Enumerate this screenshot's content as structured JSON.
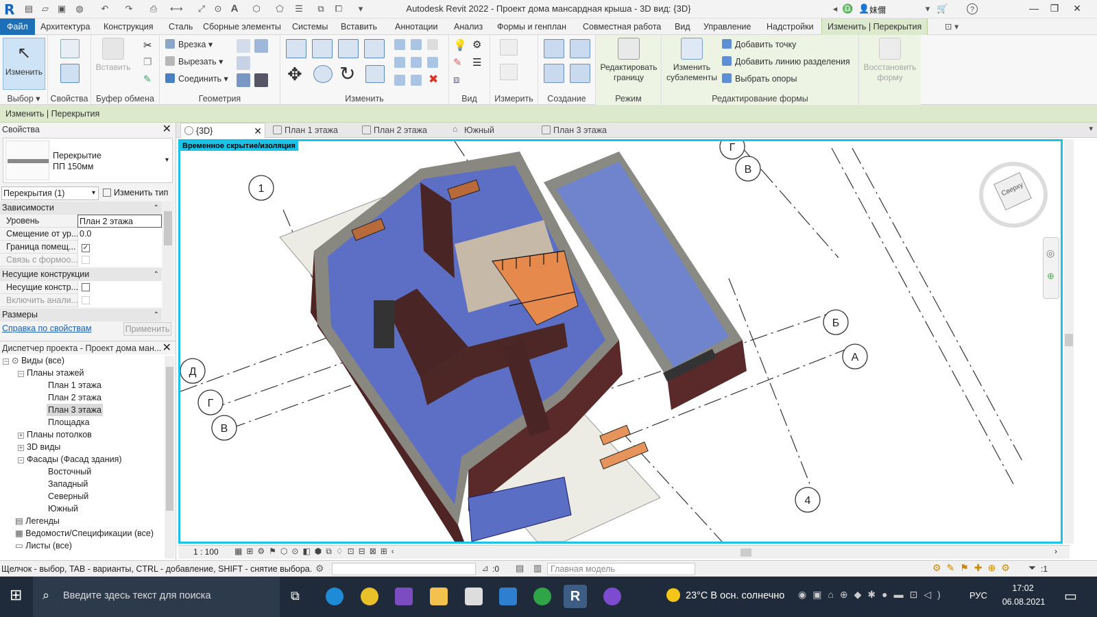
{
  "window": {
    "title": "Autodesk Revit 2022 - Проект дома мансардная крыша - 3D вид: {3D}",
    "user": "妺儞"
  },
  "menu_tabs": [
    "Файл",
    "Архитектура",
    "Конструкция",
    "Сталь",
    "Сборные элементы",
    "Системы",
    "Вставить",
    "Аннотации",
    "Анализ",
    "Формы и генплан",
    "Совместная работа",
    "Вид",
    "Управление",
    "Надстройки",
    "Изменить | Перекрытия"
  ],
  "ribbon": {
    "modify": "Изменить",
    "paste": "Вставить",
    "cut_join": [
      "Врезка",
      "Вырезать",
      "Соединить"
    ],
    "edit_boundary": "Редактировать границу",
    "modify_sub": "Изменить субэлементы",
    "shape_edit": [
      "Добавить точку",
      "Добавить линию разделения",
      "Выбрать опоры"
    ],
    "restore_shape": "Восстановить форму",
    "groups": {
      "select": "Выбор",
      "properties": "Свойства",
      "clipboard": "Буфер обмена",
      "geometry": "Геометрия",
      "modify": "Изменить",
      "view": "Вид",
      "measure": "Измерить",
      "create": "Создание",
      "mode": "Режим",
      "shape": "Редактирование формы"
    }
  },
  "option_bar": "Изменить | Перекрытия",
  "properties": {
    "title": "Свойства",
    "type_name": "Перекрытие",
    "type_sub": "ПП 150мм",
    "filter": "Перекрытия (1)",
    "edit_type": "Изменить тип",
    "cat_constraints": "Зависимости",
    "level_k": "Уровень",
    "level_v": "План 2 этажа",
    "offset_k": "Смещение от ур...",
    "offset_v": "0.0",
    "room_k": "Граница помещ...",
    "mass_k": "Связь с формоо...",
    "cat_structural": "Несущие конструкции",
    "struct_k": "Несущие констр...",
    "analytic_k": "Включить анали...",
    "cat_dimensions": "Размеры",
    "help": "Справка по свойствам",
    "apply": "Применить"
  },
  "browser": {
    "title": "Диспетчер проекта - Проект дома ман...",
    "nodes": [
      "Виды (все)",
      "Планы этажей",
      "План 1 этажа",
      "План 2 этажа",
      "План 3 этажа",
      "Площадка",
      "Планы потолков",
      "3D виды",
      "Фасады (Фасад здания)",
      "Восточный",
      "Западный",
      "Северный",
      "Южный",
      "Легенды",
      "Ведомости/Спецификации (все)",
      "Листы (все)"
    ]
  },
  "view_tabs": [
    "{3D}",
    "План 1 этажа",
    "План 2 этажа",
    "Южный",
    "План 3 этажа"
  ],
  "viewport": {
    "isolate_label": "Временное скрытие/изоляция",
    "grid_labels": [
      "1",
      "В",
      "Д",
      "Г",
      "В",
      "Б",
      "А",
      "4",
      "Г"
    ],
    "viewcube_label": "Сверху"
  },
  "view_control": {
    "scale": "1 : 100"
  },
  "status": {
    "hint": "Щелчок - выбор, TAB - варианты, CTRL - добавление, SHIFT - снятие выбора.",
    "zero": ":0",
    "model": "Главная модель",
    "filter_count": ":1"
  },
  "taskbar": {
    "search": "Введите здесь текст для поиска",
    "weather": "23°C  В осн. солнечно",
    "lang": "РУС",
    "time": "17:02",
    "date": "06.08.2021"
  }
}
